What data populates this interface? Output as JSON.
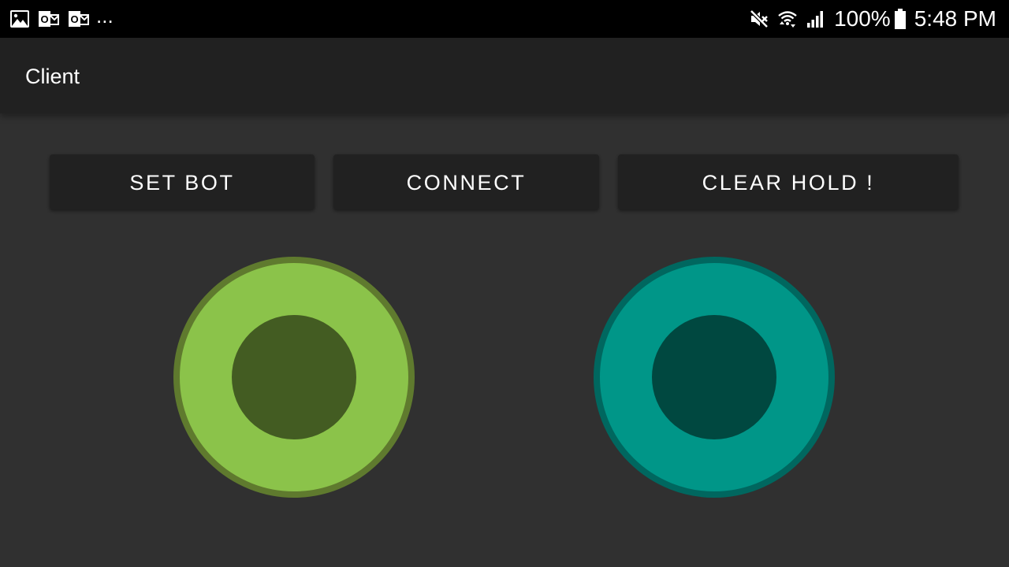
{
  "status_bar": {
    "left_icons": [
      "image-icon",
      "outlook-icon",
      "outlook-icon"
    ],
    "more_indicator": "...",
    "right_icons": [
      "mute-icon",
      "wifi-icon",
      "signal-icon"
    ],
    "battery_percent": "100%",
    "battery_icon": "battery-icon",
    "time": "5:48 PM"
  },
  "app_bar": {
    "title": "Client"
  },
  "buttons": {
    "set_bot": "SET BOT",
    "connect": "CONNECT",
    "clear_hold": "CLEAR HOLD !"
  },
  "joysticks": {
    "left": {
      "ring_color": "#8BC34A",
      "border_color": "#5F7A2E",
      "knob_color": "#435C22"
    },
    "right": {
      "ring_color": "#009688",
      "border_color": "#00675F",
      "knob_color": "#004840"
    }
  },
  "colors": {
    "status_bar_bg": "#000000",
    "app_bar_bg": "#212121",
    "content_bg": "#303030",
    "button_bg": "#212121",
    "text": "#FFFFFF"
  }
}
